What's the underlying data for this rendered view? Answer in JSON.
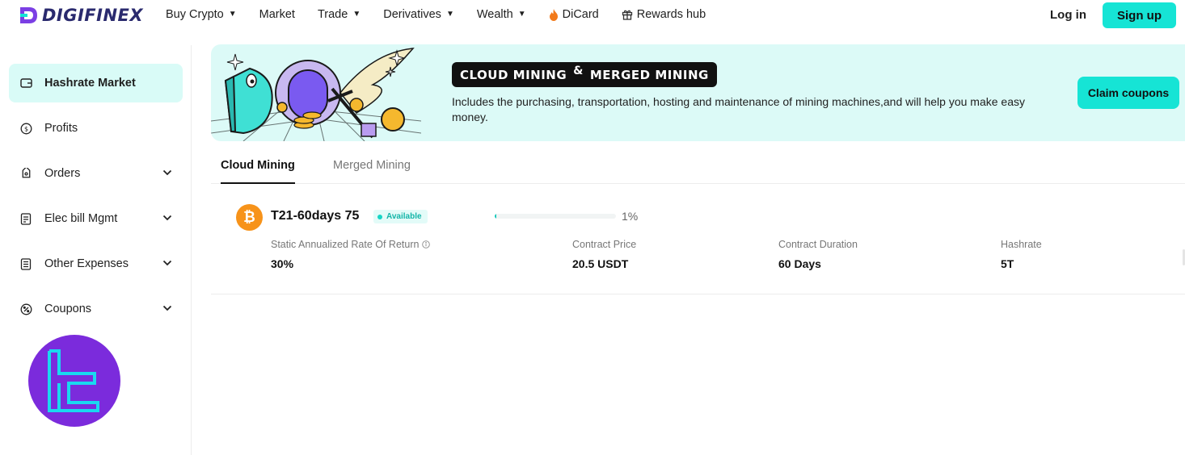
{
  "brand": {
    "name": "DIGIFINEX"
  },
  "nav": {
    "items": [
      {
        "label": "Buy Crypto",
        "dropdown": true
      },
      {
        "label": "Market",
        "dropdown": false
      },
      {
        "label": "Trade",
        "dropdown": true
      },
      {
        "label": "Derivatives",
        "dropdown": true
      },
      {
        "label": "Wealth",
        "dropdown": true
      },
      {
        "label": "DiCard",
        "icon": "flame-icon"
      },
      {
        "label": "Rewards hub",
        "icon": "gift-icon"
      }
    ],
    "login_label": "Log in",
    "signup_label": "Sign up"
  },
  "sidebar": {
    "items": [
      {
        "label": "Hashrate Market",
        "icon": "wallet-icon",
        "active": true
      },
      {
        "label": "Profits",
        "icon": "coin-icon",
        "expandable": false
      },
      {
        "label": "Orders",
        "icon": "tag-icon",
        "expandable": true
      },
      {
        "label": "Elec bill Mgmt",
        "icon": "bill-icon",
        "expandable": true
      },
      {
        "label": "Other Expenses",
        "icon": "receipt-icon",
        "expandable": true
      },
      {
        "label": "Coupons",
        "icon": "percent-icon",
        "expandable": true
      }
    ]
  },
  "banner": {
    "tag_left": "CLOUD MINING",
    "tag_amp": "&",
    "tag_right": "MERGED MINING",
    "description": "Includes the purchasing, transportation, hosting and maintenance of mining machines,and will help you make easy money.",
    "claim_label": "Claim coupons"
  },
  "tabs": [
    {
      "label": "Cloud Mining",
      "active": true
    },
    {
      "label": "Merged Mining",
      "active": false
    }
  ],
  "product": {
    "coin_symbol": "₿",
    "name": "T21-60days 75",
    "status": "Available",
    "progress_fraction": 0.01,
    "progress_label": "1%",
    "stats": [
      {
        "label": "Static Annualized Rate Of Return",
        "value": "30%",
        "has_info": true
      },
      {
        "label": "Contract Price",
        "value": "20.5 USDT"
      },
      {
        "label": "Contract Duration",
        "value": "60 Days"
      },
      {
        "label": "Hashrate",
        "value": "5T"
      }
    ]
  },
  "colors": {
    "accent": "#16e4d5",
    "active_bg": "#d9fbf7",
    "banner_bg": "#dcfaf7",
    "bitcoin": "#f7931a",
    "badge_purple": "#7b2bdc"
  }
}
